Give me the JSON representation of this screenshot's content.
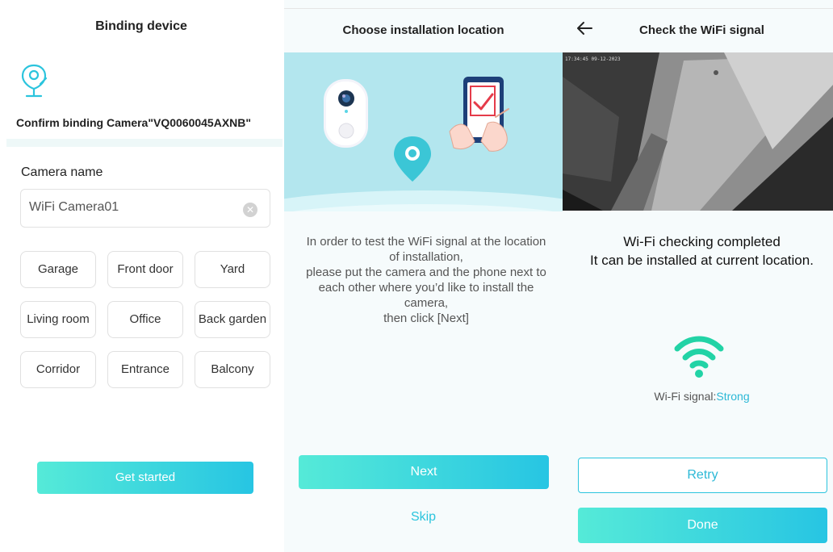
{
  "screen1": {
    "title": "Binding device",
    "confirm_text": "Confirm binding  Camera\"VQ0060045AXNB\"",
    "camera_name_label": "Camera name",
    "camera_name_value": "WiFi Camera01",
    "locations": [
      "Garage",
      "Front door",
      "Yard",
      "Living room",
      "Office",
      "Back garden",
      "Corridor",
      "Entrance",
      "Balcony"
    ],
    "get_started_label": "Get started",
    "icons": {
      "camera": "camera-location-icon",
      "clear": "clear-icon"
    }
  },
  "screen2": {
    "title": "Choose installation location",
    "instructions": [
      "In order to test the WiFi signal at the location",
      "of installation,",
      "please put the camera and the phone next to",
      "each other where you’d like to install the",
      "camera,",
      "then click [Next]"
    ],
    "next_label": "Next",
    "skip_label": "Skip",
    "icons": {
      "illustration": "camera-phone-illustration"
    }
  },
  "screen3": {
    "title": "Check the WiFi signal",
    "feed_timestamp": "17:34:45 09-12-2023",
    "result_line1": "Wi-Fi checking completed",
    "result_line2": "It can be installed at current location.",
    "signal_label": "Wi-Fi signal:",
    "signal_value": "Strong",
    "retry_label": "Retry",
    "done_label": "Done",
    "icons": {
      "back": "back-arrow-icon",
      "wifi": "wifi-icon"
    }
  },
  "colors": {
    "accent": "#2bc4dd",
    "gradient_start": "#55ead8",
    "gradient_end": "#27c5e3",
    "illustration_bg": "#b3e6ee"
  }
}
